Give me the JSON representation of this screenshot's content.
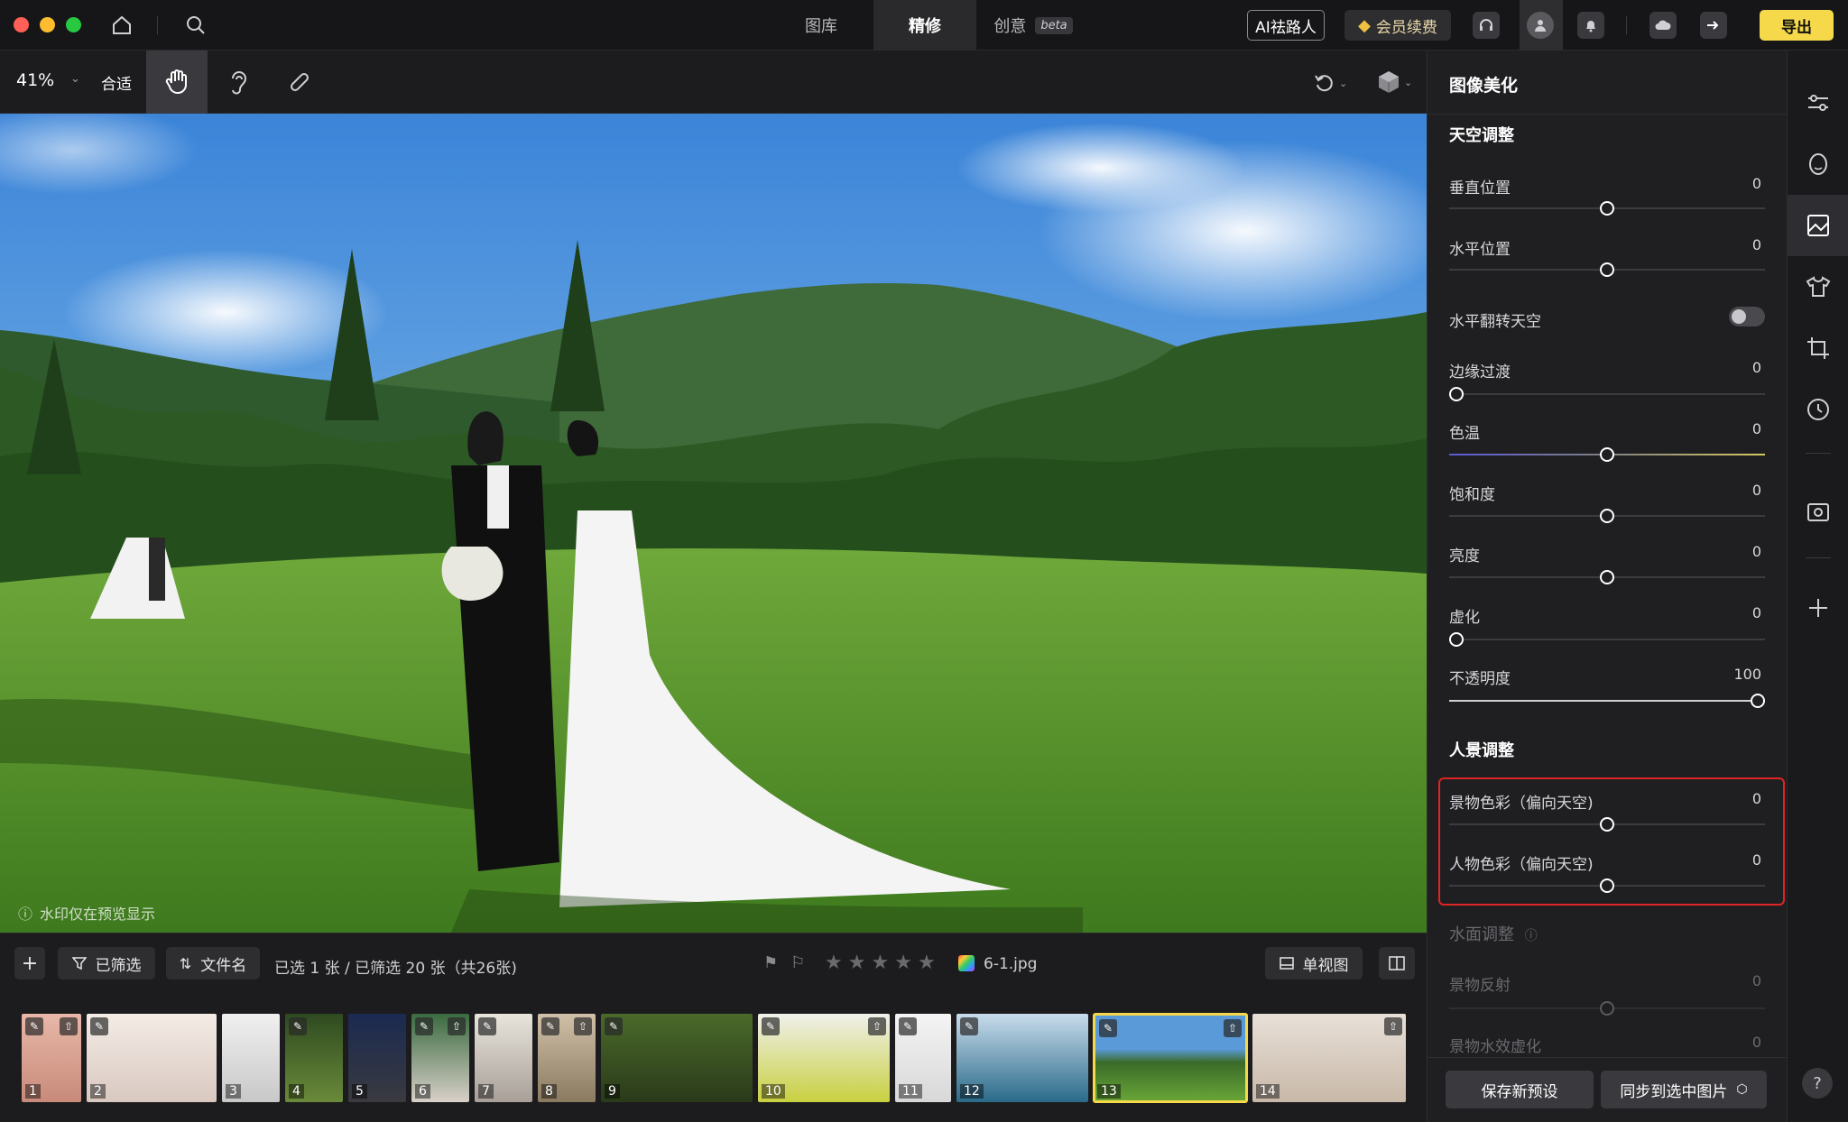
{
  "titlebar": {
    "tabs": [
      {
        "label": "图库"
      },
      {
        "label": "精修"
      },
      {
        "label": "创意"
      }
    ],
    "beta": "beta",
    "ai_button": "AI祛路人",
    "member_button": "会员续费",
    "export_button": "导出"
  },
  "toolbar": {
    "zoom": "41%",
    "fit": "合适"
  },
  "canvas": {
    "watermark_note": "水印仅在预览显示"
  },
  "filterbar": {
    "filtered": "已筛选",
    "filename": "文件名",
    "status": "已选 1 张 / 已筛选 20 张（共26张)",
    "current_file": "6-1.jpg",
    "view_mode": "单视图"
  },
  "filmstrip": {
    "thumbs": [
      "1",
      "2",
      "3",
      "4",
      "5",
      "6",
      "7",
      "8",
      "9",
      "10",
      "11",
      "12",
      "13",
      "14"
    ],
    "selected": "13"
  },
  "panel": {
    "title": "图像美化",
    "sky_title": "天空调整",
    "sky_rows": [
      {
        "label": "垂直位置",
        "value": "0"
      },
      {
        "label": "水平位置",
        "value": "0"
      },
      {
        "label": "水平翻转天空"
      },
      {
        "label": "边缘过渡",
        "value": "0"
      },
      {
        "label": "色温",
        "value": "0"
      },
      {
        "label": "饱和度",
        "value": "0"
      },
      {
        "label": "亮度",
        "value": "0"
      },
      {
        "label": "虚化",
        "value": "0"
      },
      {
        "label": "不透明度",
        "value": "100"
      }
    ],
    "portrait_title": "人景调整",
    "portrait_rows": [
      {
        "label": "景物色彩（偏向天空)",
        "value": "0"
      },
      {
        "label": "人物色彩（偏向天空)",
        "value": "0"
      }
    ],
    "water_title": "水面调整",
    "water_rows": [
      {
        "label": "景物反射",
        "value": "0"
      },
      {
        "label": "景物水效虚化",
        "value": "0"
      }
    ],
    "save_preset": "保存新预设",
    "sync_selected": "同步到选中图片"
  },
  "colors": {
    "accent_yellow": "#f5d94a",
    "highlight_red": "#e02424"
  }
}
